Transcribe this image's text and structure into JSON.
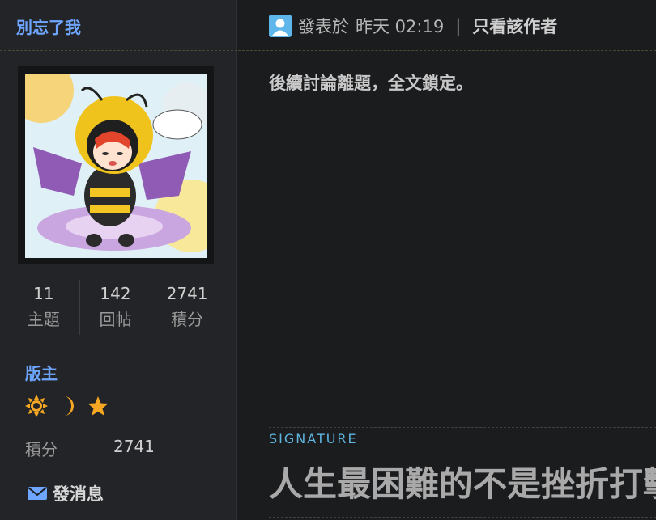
{
  "user": {
    "name": "別忘了我",
    "rank": "版主"
  },
  "stats": [
    {
      "value": "11",
      "label": "主題"
    },
    {
      "value": "142",
      "label": "回帖"
    },
    {
      "value": "2741",
      "label": "積分"
    }
  ],
  "credit": {
    "label": "積分",
    "value": "2741"
  },
  "actions": {
    "send_message": "發消息"
  },
  "post": {
    "posted_prefix": "發表於",
    "posted_time": "昨天 02:19",
    "separator": "|",
    "only_author": "只看該作者",
    "body": "後續討論離題，全文鎖定。"
  },
  "signature": {
    "label": "SIGNATURE",
    "text": "人生最困難的不是挫折打擊"
  },
  "colors": {
    "link_blue": "#6ea6ff",
    "badge_orange": "#f5a623",
    "signature_label": "#5fb4e0"
  },
  "icons": [
    "user-icon",
    "sun-badge-icon",
    "moon-badge-icon",
    "star-badge-icon",
    "mail-icon"
  ]
}
